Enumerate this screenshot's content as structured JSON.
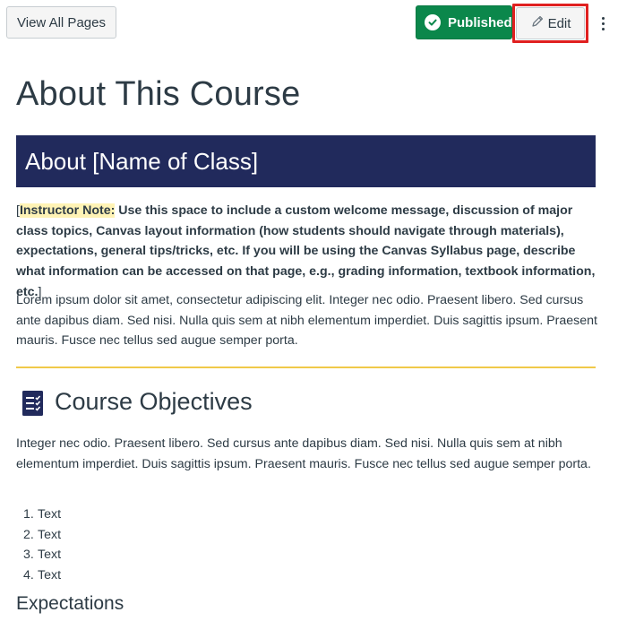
{
  "toolbar": {
    "view_all_label": "View All Pages",
    "published_label": "Published",
    "edit_label": "Edit",
    "more_icon": "more-vertical-icon"
  },
  "page": {
    "title": "About This Course"
  },
  "banner": {
    "title": "About [Name of Class]"
  },
  "instructor_note": {
    "open_bracket": "[",
    "label": "Instructor Note:",
    "text": " Use this space to include a custom welcome message, discussion of major class topics, Canvas layout information (how students should navigate through materials), expectations, general tips/tricks, etc. If you will be using the Canvas Syllabus page, describe what information can be accessed on that page, e.g., grading information, textbook information, etc.",
    "close_bracket": "]"
  },
  "intro_paragraph": "Lorem ipsum dolor sit amet, consectetur adipiscing elit. Integer nec odio. Praesent libero. Sed cursus ante dapibus diam. Sed nisi. Nulla quis sem at nibh elementum imperdiet. Duis sagittis ipsum. Praesent mauris. Fusce nec tellus sed augue semper porta.",
  "objectives": {
    "heading": "Course Objectives",
    "paragraph": "Integer nec odio. Praesent libero. Sed cursus ante dapibus diam. Sed nisi. Nulla quis sem at nibh elementum imperdiet. Duis sagittis ipsum. Praesent mauris. Fusce nec tellus sed augue semper porta.",
    "items": [
      {
        "num": "1.",
        "text": "Text"
      },
      {
        "num": "2.",
        "text": "Text"
      },
      {
        "num": "3.",
        "text": "Text"
      },
      {
        "num": "4.",
        "text": "Text"
      }
    ]
  },
  "expectations": {
    "heading": "Expectations"
  },
  "colors": {
    "published_green": "#0b874b",
    "banner_navy": "#212a5c",
    "divider_gold": "#f0c94a",
    "highlight_yellow": "#fff3b5",
    "edit_outline_red": "#e02020"
  }
}
